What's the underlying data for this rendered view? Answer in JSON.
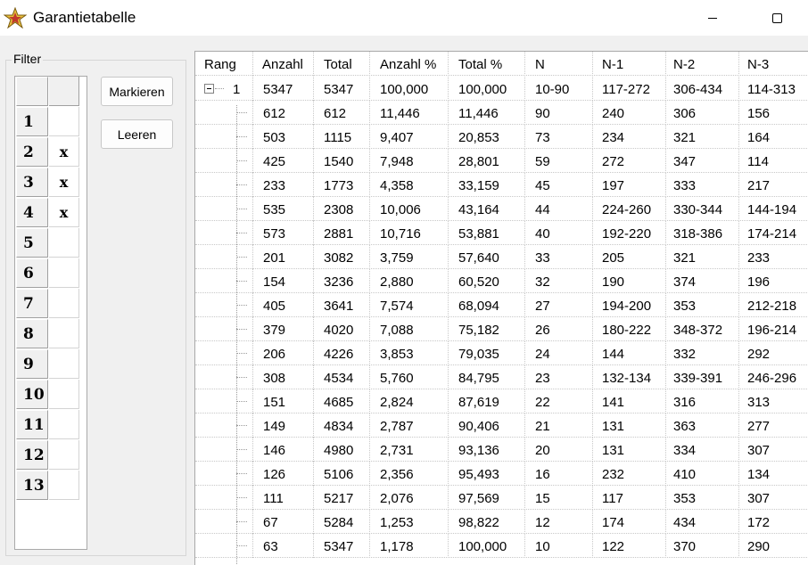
{
  "window": {
    "title": "Garantietabelle",
    "icon": "app-star-icon"
  },
  "filter": {
    "legend": "Filter",
    "rows": [
      {
        "num": "1",
        "mark": ""
      },
      {
        "num": "2",
        "mark": "x"
      },
      {
        "num": "3",
        "mark": "x"
      },
      {
        "num": "4",
        "mark": "x"
      },
      {
        "num": "5",
        "mark": ""
      },
      {
        "num": "6",
        "mark": ""
      },
      {
        "num": "7",
        "mark": ""
      },
      {
        "num": "8",
        "mark": ""
      },
      {
        "num": "9",
        "mark": ""
      },
      {
        "num": "10",
        "mark": ""
      },
      {
        "num": "11",
        "mark": ""
      },
      {
        "num": "12",
        "mark": ""
      },
      {
        "num": "13",
        "mark": ""
      }
    ]
  },
  "buttons": {
    "mark": "Markieren",
    "clear": "Leeren"
  },
  "table": {
    "columns": [
      "Rang",
      "Anzahl",
      "Total",
      "Anzahl %",
      "Total %",
      "N",
      "N-1",
      "N-2",
      "N-3"
    ],
    "parent": {
      "rank": "1",
      "cells": [
        "5347",
        "5347",
        "100,000",
        "100,000",
        "10-90",
        "117-272",
        "306-434",
        "114-313"
      ]
    },
    "rows": [
      [
        "612",
        "612",
        "11,446",
        "11,446",
        "90",
        "240",
        "306",
        "156"
      ],
      [
        "503",
        "1115",
        "9,407",
        "20,853",
        "73",
        "234",
        "321",
        "164"
      ],
      [
        "425",
        "1540",
        "7,948",
        "28,801",
        "59",
        "272",
        "347",
        "114"
      ],
      [
        "233",
        "1773",
        "4,358",
        "33,159",
        "45",
        "197",
        "333",
        "217"
      ],
      [
        "535",
        "2308",
        "10,006",
        "43,164",
        "44",
        "224-260",
        "330-344",
        "144-194"
      ],
      [
        "573",
        "2881",
        "10,716",
        "53,881",
        "40",
        "192-220",
        "318-386",
        "174-214"
      ],
      [
        "201",
        "3082",
        "3,759",
        "57,640",
        "33",
        "205",
        "321",
        "233"
      ],
      [
        "154",
        "3236",
        "2,880",
        "60,520",
        "32",
        "190",
        "374",
        "196"
      ],
      [
        "405",
        "3641",
        "7,574",
        "68,094",
        "27",
        "194-200",
        "353",
        "212-218"
      ],
      [
        "379",
        "4020",
        "7,088",
        "75,182",
        "26",
        "180-222",
        "348-372",
        "196-214"
      ],
      [
        "206",
        "4226",
        "3,853",
        "79,035",
        "24",
        "144",
        "332",
        "292"
      ],
      [
        "308",
        "4534",
        "5,760",
        "84,795",
        "23",
        "132-134",
        "339-391",
        "246-296"
      ],
      [
        "151",
        "4685",
        "2,824",
        "87,619",
        "22",
        "141",
        "316",
        "313"
      ],
      [
        "149",
        "4834",
        "2,787",
        "90,406",
        "21",
        "131",
        "363",
        "277"
      ],
      [
        "146",
        "4980",
        "2,731",
        "93,136",
        "20",
        "131",
        "334",
        "307"
      ],
      [
        "126",
        "5106",
        "2,356",
        "95,493",
        "16",
        "232",
        "410",
        "134"
      ],
      [
        "111",
        "5217",
        "2,076",
        "97,569",
        "15",
        "117",
        "353",
        "307"
      ],
      [
        "67",
        "5284",
        "1,253",
        "98,822",
        "12",
        "174",
        "434",
        "172"
      ],
      [
        "63",
        "5347",
        "1,178",
        "100,000",
        "10",
        "122",
        "370",
        "290"
      ]
    ]
  }
}
